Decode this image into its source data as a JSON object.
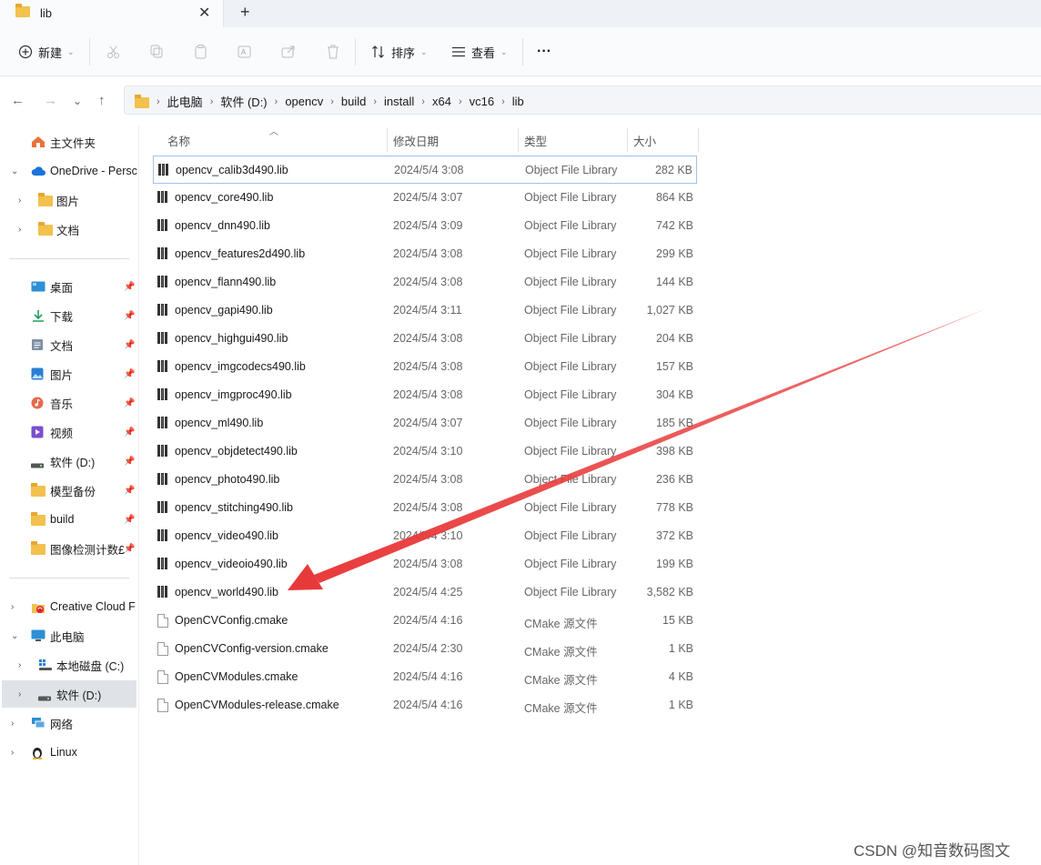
{
  "tab": {
    "title": "lib",
    "close": "✕",
    "new": "+"
  },
  "toolbar": {
    "new_label": "新建",
    "sort_label": "排序",
    "view_label": "查看",
    "more": "···"
  },
  "breadcrumbs": [
    "此电脑",
    "软件 (D:)",
    "opencv",
    "build",
    "install",
    "x64",
    "vc16",
    "lib"
  ],
  "sidebar": {
    "home": "主文件夹",
    "onedrive": "OneDrive - Persc",
    "pictures_od": "图片",
    "docs_od": "文档",
    "quick": [
      {
        "label": "桌面",
        "icon": "desktop-icon"
      },
      {
        "label": "下载",
        "icon": "download-icon"
      },
      {
        "label": "文档",
        "icon": "document-icon"
      },
      {
        "label": "图片",
        "icon": "picture-icon"
      },
      {
        "label": "音乐",
        "icon": "music-icon"
      },
      {
        "label": "视频",
        "icon": "video-icon"
      },
      {
        "label": "软件 (D:)",
        "icon": "drive-icon"
      },
      {
        "label": "模型备份",
        "icon": "folder-icon"
      },
      {
        "label": "build",
        "icon": "folder-icon"
      },
      {
        "label": "图像检测计数£",
        "icon": "folder-icon"
      }
    ],
    "creative_cloud": "Creative Cloud F",
    "this_pc": "此电脑",
    "drive_c": "本地磁盘 (C:)",
    "drive_d": "软件 (D:)",
    "network": "网络",
    "linux": "Linux"
  },
  "columns": {
    "name": "名称",
    "date": "修改日期",
    "type": "类型",
    "size": "大小"
  },
  "files": [
    {
      "name": "opencv_calib3d490.lib",
      "date": "2024/5/4 3:08",
      "type": "Object File Library",
      "size": "282 KB",
      "kind": "lib"
    },
    {
      "name": "opencv_core490.lib",
      "date": "2024/5/4 3:07",
      "type": "Object File Library",
      "size": "864 KB",
      "kind": "lib"
    },
    {
      "name": "opencv_dnn490.lib",
      "date": "2024/5/4 3:09",
      "type": "Object File Library",
      "size": "742 KB",
      "kind": "lib"
    },
    {
      "name": "opencv_features2d490.lib",
      "date": "2024/5/4 3:08",
      "type": "Object File Library",
      "size": "299 KB",
      "kind": "lib"
    },
    {
      "name": "opencv_flann490.lib",
      "date": "2024/5/4 3:08",
      "type": "Object File Library",
      "size": "144 KB",
      "kind": "lib"
    },
    {
      "name": "opencv_gapi490.lib",
      "date": "2024/5/4 3:11",
      "type": "Object File Library",
      "size": "1,027 KB",
      "kind": "lib"
    },
    {
      "name": "opencv_highgui490.lib",
      "date": "2024/5/4 3:08",
      "type": "Object File Library",
      "size": "204 KB",
      "kind": "lib"
    },
    {
      "name": "opencv_imgcodecs490.lib",
      "date": "2024/5/4 3:08",
      "type": "Object File Library",
      "size": "157 KB",
      "kind": "lib"
    },
    {
      "name": "opencv_imgproc490.lib",
      "date": "2024/5/4 3:08",
      "type": "Object File Library",
      "size": "304 KB",
      "kind": "lib"
    },
    {
      "name": "opencv_ml490.lib",
      "date": "2024/5/4 3:07",
      "type": "Object File Library",
      "size": "185 KB",
      "kind": "lib"
    },
    {
      "name": "opencv_objdetect490.lib",
      "date": "2024/5/4 3:10",
      "type": "Object File Library",
      "size": "398 KB",
      "kind": "lib"
    },
    {
      "name": "opencv_photo490.lib",
      "date": "2024/5/4 3:08",
      "type": "Object File Library",
      "size": "236 KB",
      "kind": "lib"
    },
    {
      "name": "opencv_stitching490.lib",
      "date": "2024/5/4 3:08",
      "type": "Object File Library",
      "size": "778 KB",
      "kind": "lib"
    },
    {
      "name": "opencv_video490.lib",
      "date": "2024/5/4 3:10",
      "type": "Object File Library",
      "size": "372 KB",
      "kind": "lib"
    },
    {
      "name": "opencv_videoio490.lib",
      "date": "2024/5/4 3:08",
      "type": "Object File Library",
      "size": "199 KB",
      "kind": "lib"
    },
    {
      "name": "opencv_world490.lib",
      "date": "2024/5/4 4:25",
      "type": "Object File Library",
      "size": "3,582 KB",
      "kind": "lib"
    },
    {
      "name": "OpenCVConfig.cmake",
      "date": "2024/5/4 4:16",
      "type": "CMake 源文件",
      "size": "15 KB",
      "kind": "doc"
    },
    {
      "name": "OpenCVConfig-version.cmake",
      "date": "2024/5/4 2:30",
      "type": "CMake 源文件",
      "size": "1 KB",
      "kind": "doc"
    },
    {
      "name": "OpenCVModules.cmake",
      "date": "2024/5/4 4:16",
      "type": "CMake 源文件",
      "size": "4 KB",
      "kind": "doc"
    },
    {
      "name": "OpenCVModules-release.cmake",
      "date": "2024/5/4 4:16",
      "type": "CMake 源文件",
      "size": "1 KB",
      "kind": "doc"
    }
  ],
  "watermark": "CSDN @知音数码图文",
  "colors": {
    "annotation_arrow": "#e8393a",
    "folder": "#f2c14e",
    "selection": "#dfe3e8"
  }
}
